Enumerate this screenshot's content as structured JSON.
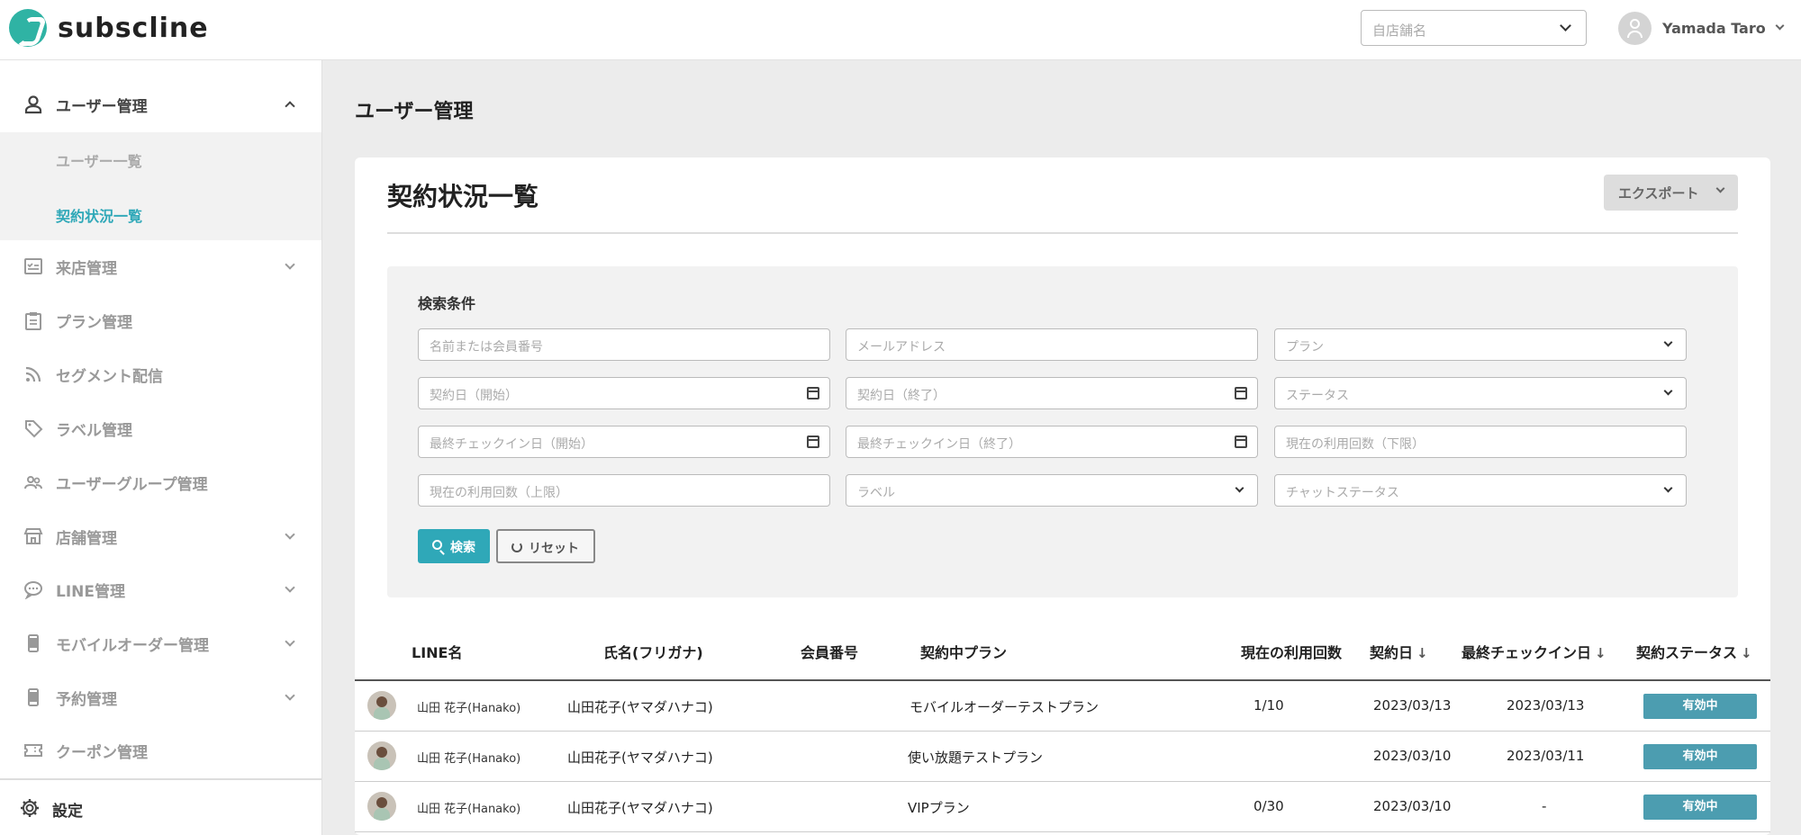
{
  "header": {
    "logo_text": "subscline",
    "store_placeholder": "自店舗名",
    "user_name": "Yamada Taro"
  },
  "sidebar": {
    "user_mgmt": "ユーザー管理",
    "sub_items": [
      "ユーザー一覧",
      "契約状況一覧"
    ],
    "items": [
      {
        "label": "来店管理",
        "icon": "checklist-icon"
      },
      {
        "label": "プラン管理",
        "icon": "clipboard-icon"
      },
      {
        "label": "セグメント配信",
        "icon": "rss-icon"
      },
      {
        "label": "ラベル管理",
        "icon": "tag-icon"
      },
      {
        "label": "ユーザーグループ管理",
        "icon": "group-icon"
      },
      {
        "label": "店舗管理",
        "icon": "store-icon"
      },
      {
        "label": "LINE管理",
        "icon": "chat-icon"
      },
      {
        "label": "モバイルオーダー管理",
        "icon": "phone-icon"
      },
      {
        "label": "予約管理",
        "icon": "phone-icon"
      },
      {
        "label": "クーポン管理",
        "icon": "ticket-icon"
      }
    ],
    "settings": "設定"
  },
  "main": {
    "page_title": "ユーザー管理",
    "card_title": "契約状況一覧",
    "export_label": "エクスポート",
    "search": {
      "label": "検索条件",
      "fields": [
        "名前または会員番号",
        "メールアドレス",
        "プラン",
        "契約日（開始）",
        "契約日（終了）",
        "ステータス",
        "最終チェックイン日（開始）",
        "最終チェックイン日（終了）",
        "現在の利用回数（下限）",
        "現在の利用回数（上限）",
        "ラベル",
        "チャットステータス"
      ],
      "search_button": "検索",
      "reset_button": "リセット"
    },
    "table": {
      "headers": [
        "LINE名",
        "氏名(フリガナ)",
        "会員番号",
        "契約中プラン",
        "現在の利用回数",
        "契約日",
        "最終チェックイン日",
        "契約ステータス"
      ],
      "sort_arrow": "↓",
      "rows": [
        {
          "line_name": "山田 花子(Hanako)",
          "name": "山田花子(ヤマダハナコ)",
          "member_no": "",
          "plan": "モバイルオーダーテストプラン",
          "usage": "1/10",
          "contract_date": "2023/03/13",
          "last_checkin": "2023/03/13",
          "status": "有効中"
        },
        {
          "line_name": "山田 花子(Hanako)",
          "name": "山田花子(ヤマダハナコ)",
          "member_no": "",
          "plan": "使い放題テストプラン",
          "usage": "",
          "contract_date": "2023/03/10",
          "last_checkin": "2023/03/11",
          "status": "有効中"
        },
        {
          "line_name": "山田 花子(Hanako)",
          "name": "山田花子(ヤマダハナコ)",
          "member_no": "",
          "plan": "VIPプラン",
          "usage": "0/30",
          "contract_date": "2023/03/10",
          "last_checkin": "-",
          "status": "有効中"
        }
      ]
    }
  },
  "colors": {
    "accent": "#2fa8b8",
    "logo": "#2fb3a4",
    "status_badge": "#4c9db0"
  }
}
